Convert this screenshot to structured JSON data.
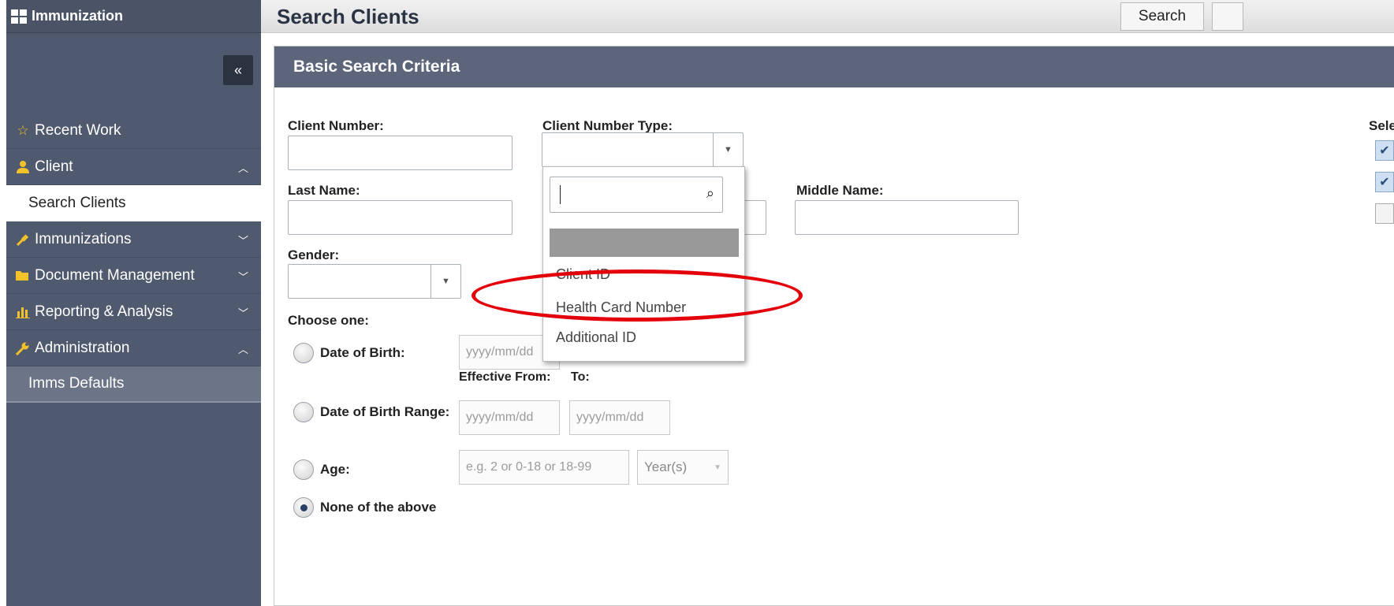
{
  "app": {
    "title": "Immunization"
  },
  "sidebar": {
    "collapse_label": "«",
    "items": [
      {
        "label": "Recent Work",
        "icon": "star-outline-icon"
      },
      {
        "label": "Client",
        "icon": "person-icon",
        "expanded": true
      },
      {
        "label": "Search Clients",
        "active": true
      },
      {
        "label": "Immunizations",
        "icon": "syringe-icon"
      },
      {
        "label": "Document Management",
        "icon": "folder-icon"
      },
      {
        "label": "Reporting & Analysis",
        "icon": "bar-chart-icon"
      },
      {
        "label": "Administration",
        "icon": "wrench-icon",
        "expanded": true
      },
      {
        "label": "Imms Defaults"
      }
    ]
  },
  "header": {
    "title": "Search Clients",
    "search_button": "Search"
  },
  "panel": {
    "title": "Basic Search Criteria",
    "client_number_label": "Client Number:",
    "client_number_type_label": "Client Number Type:",
    "last_name_label": "Last Name:",
    "middle_name_label": "Middle Name:",
    "gender_label": "Gender:",
    "choose_one_label": "Choose one:",
    "dob_label": "Date of Birth:",
    "dob_placeholder": "yyyy/mm/dd",
    "effective_from_label": "Effective From:",
    "to_label": "To:",
    "dob_range_label": "Date of Birth Range:",
    "from_placeholder": "yyyy/mm/dd",
    "to_placeholder": "yyyy/mm/dd",
    "age_label": "Age:",
    "age_placeholder": "e.g. 2 or 0-18 or 18-99",
    "age_unit": "Year(s)",
    "none_label": "None of the above",
    "right_label": "Sele"
  },
  "dropdown": {
    "options": [
      "Client ID",
      "Health Card Number",
      "Additional ID"
    ]
  },
  "colors": {
    "sidebar_bg": "#505a6e",
    "panel_header_bg": "#5c6579",
    "icon_accent": "#f3c22a",
    "annotation": "#e3000b"
  }
}
